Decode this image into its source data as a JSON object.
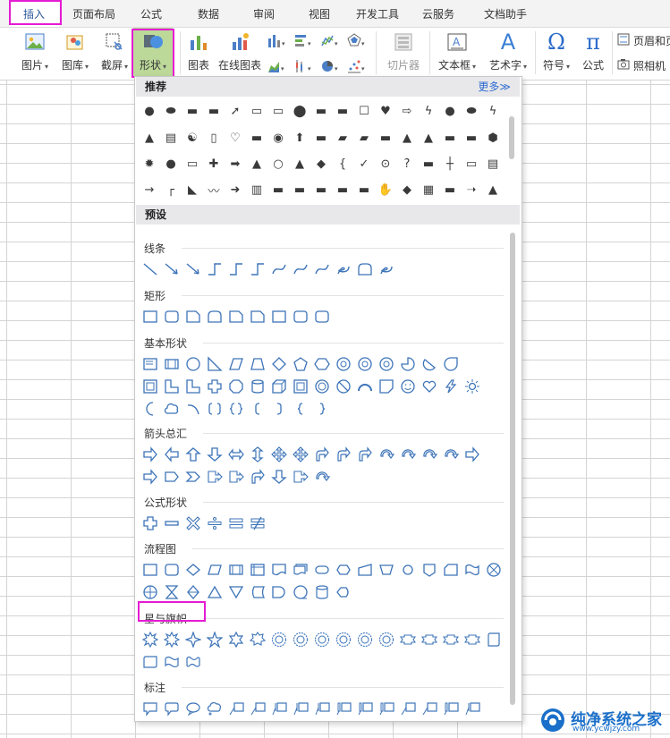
{
  "tabs": [
    {
      "label": "插入",
      "active": true
    },
    {
      "label": "页面布局"
    },
    {
      "label": "公式"
    },
    {
      "label": "数据"
    },
    {
      "label": "审阅"
    },
    {
      "label": "视图"
    },
    {
      "label": "开发工具"
    },
    {
      "label": "云服务"
    },
    {
      "label": "文档助手"
    }
  ],
  "ribbon": {
    "picture": "图片",
    "gallery": "图库",
    "screenshot": "截屏",
    "shapes": "形状",
    "chart": "图表",
    "online_chart": "在线图表",
    "clip": "切片器",
    "textbox": "文本框",
    "wordart": "艺术字",
    "symbol": "符号",
    "formula": "公式",
    "header_footer": "页眉和页脚",
    "camera": "照相机"
  },
  "panel": {
    "recommend": "推荐",
    "more": "更多≫",
    "preset": "预设",
    "categories": {
      "lines": "线条",
      "rect": "矩形",
      "basic": "基本形状",
      "arrows": "箭头总汇",
      "equation": "公式形状",
      "flowchart": "流程图",
      "stars": "星与旗帜",
      "callouts": "标注"
    }
  },
  "watermark": {
    "title": "纯净系统之家",
    "url": "www.ycwjzy.com"
  },
  "colors": {
    "accent": "#2b579a",
    "highlight": "#e51bd3",
    "shape_outline": "#3d74b8"
  }
}
